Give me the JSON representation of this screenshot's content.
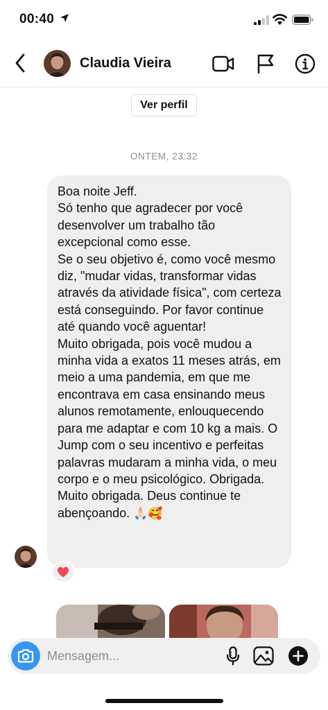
{
  "status_bar": {
    "time": "00:40"
  },
  "header": {
    "contact_name": "Claudia Vieira"
  },
  "profile_button": "Ver perfil",
  "timestamp": "ONTEM, 23:32",
  "message": {
    "paragraphs": [
      "Boa noite Jeff.",
      "Só tenho que agradecer por você desenvolver um trabalho tão excepcional como esse.",
      "Se o seu objetivo é, como você mesmo diz, \"mudar vidas, transformar vidas através da atividade física\", com certeza está conseguindo. Por favor continue até quando você aguentar!",
      "Muito obrigada, pois você mudou a minha vida a exatos 11 meses atrás, em meio a uma pandemia, em que me encontrava em casa ensinando meus alunos remotamente, enlouquecendo para me adaptar e com 10 kg a mais. O Jump com o seu incentivo e perfeitas palavras mudaram a minha vida, o meu corpo e o meu psicológico. Obrigada. Muito obrigada. Deus continue te abençoando."
    ],
    "trailing_emojis": "🙏🏻🥰",
    "reaction": "heart"
  },
  "composer": {
    "placeholder": "Mensagem..."
  },
  "colors": {
    "accent": "#3797f0",
    "bubble": "#efefef",
    "reaction_heart": "#ed4956"
  },
  "icons": [
    "back-chevron-icon",
    "video-call-icon",
    "flag-icon",
    "info-icon",
    "camera-icon",
    "microphone-icon",
    "gallery-icon",
    "plus-icon"
  ]
}
